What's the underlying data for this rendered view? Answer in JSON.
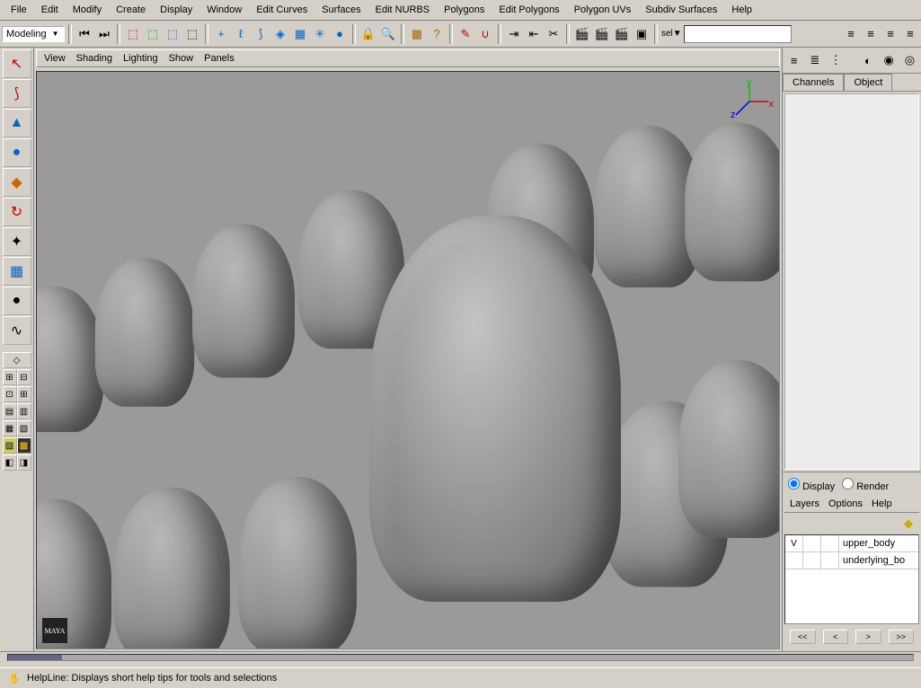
{
  "menubar": [
    "File",
    "Edit",
    "Modify",
    "Create",
    "Display",
    "Window",
    "Edit Curves",
    "Surfaces",
    "Edit NURBS",
    "Polygons",
    "Edit Polygons",
    "Polygon UVs",
    "Subdiv Surfaces",
    "Help"
  ],
  "mode_dropdown": "Modeling",
  "sel_label": "sel▼",
  "panel_menu": [
    "View",
    "Shading",
    "Lighting",
    "Show",
    "Panels"
  ],
  "axis": {
    "x": "x",
    "y": "y",
    "z": "z"
  },
  "channel_tabs": [
    "Channels",
    "Object"
  ],
  "layer_radios": {
    "display": "Display",
    "render": "Render"
  },
  "layer_menu": [
    "Layers",
    "Options",
    "Help"
  ],
  "layers": [
    {
      "vis": "V",
      "name": "upper_body"
    },
    {
      "vis": "",
      "name": "underlying_bo"
    }
  ],
  "sliders": [
    "<<",
    "<",
    ">",
    ">>"
  ],
  "helpline_label": "HelpLine:",
  "helpline_text": "Displays short help tips for tools and selections",
  "maya_logo": "MAYA",
  "toolbar_icons": [
    "playback-start",
    "playback-step",
    "divider",
    "hierarchy",
    "select-object",
    "select-component",
    "select-hierarchy",
    "divider",
    "snap-grid",
    "add",
    "curve",
    "lasso",
    "cube",
    "lattice",
    "particle",
    "sphere",
    "divider",
    "lock",
    "search",
    "divider",
    "grid",
    "help",
    "divider",
    "paint",
    "magnet",
    "divider",
    "import",
    "export",
    "script",
    "divider",
    "clapboard-1",
    "clapboard-2",
    "clapboard-3",
    "render"
  ],
  "toolbox": {
    "main_tools": [
      "select-arrow",
      "lasso",
      "rotate-cone",
      "move-sphere",
      "scale-book",
      "rotate-arrows",
      "manipulator",
      "uv-grid",
      "paint-weights",
      "point",
      "curve-draw"
    ],
    "layout_presets": [
      "single",
      "four-view",
      "two-horiz",
      "two-vert",
      "persp-outliner",
      "hypershade",
      "graph",
      "script",
      "render",
      "custom-1",
      "custom-2"
    ]
  },
  "right_toolbar_icons": [
    "attr-list",
    "attr-spread",
    "attr-channel",
    "isolate",
    "isolate-sphere",
    "isolate-wire"
  ]
}
